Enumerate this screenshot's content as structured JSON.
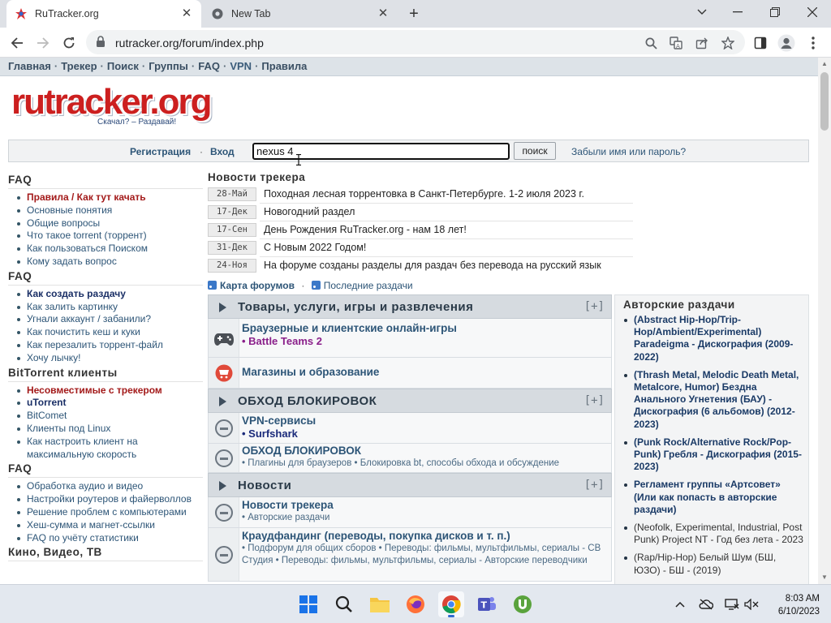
{
  "browser": {
    "tabs": [
      {
        "title": "RuTracker.org",
        "active": true
      },
      {
        "title": "New Tab",
        "active": false
      }
    ],
    "url": "rutracker.org/forum/index.php"
  },
  "topnav": {
    "items": [
      "Главная",
      "Трекер",
      "Поиск",
      "Группы",
      "FAQ",
      "VPN",
      "Правила"
    ],
    "separator": "·"
  },
  "logo": {
    "text": "rutracker.org",
    "slogan": "Скачал? – Раздавай!"
  },
  "login": {
    "register": "Регистрация",
    "dot": "·",
    "login": "Вход",
    "search_value": "nexus 4",
    "search_button": "поиск",
    "forgot": "Забыли имя или пароль?"
  },
  "sidebar": {
    "sections": [
      {
        "title": "FAQ",
        "items": [
          {
            "label": "Правила / Как тут качать",
            "style": "red"
          },
          {
            "label": "Основные понятия"
          },
          {
            "label": "Общие вопросы"
          },
          {
            "label": "Что такое torrent (торрент)"
          },
          {
            "label": "Как пользоваться Поиском"
          },
          {
            "label": "Кому задать вопрос"
          }
        ]
      },
      {
        "title": "FAQ",
        "items": [
          {
            "label": "Как создать раздачу",
            "style": "dark"
          },
          {
            "label": "Как залить картинку"
          },
          {
            "label": "Угнали аккаунт / забанили?"
          },
          {
            "label": "Как почистить кеш и куки"
          },
          {
            "label": "Как перезалить торрент-файл"
          },
          {
            "label": "Хочу лычку!"
          }
        ]
      },
      {
        "title": "BitTorrent клиенты",
        "items": [
          {
            "label": "Несовместимые с трекером",
            "style": "red"
          },
          {
            "label": "uTorrent",
            "style": "dark"
          },
          {
            "label": "BitComet"
          },
          {
            "label": "Клиенты под Linux"
          },
          {
            "label": "Как настроить клиент на максимальную скорость"
          }
        ]
      },
      {
        "title": "FAQ",
        "items": [
          {
            "label": "Обработка аудио и видео"
          },
          {
            "label": "Настройки роутеров и файерволлов"
          },
          {
            "label": "Решение проблем с компьютерами"
          },
          {
            "label": "Хеш-сумма и магнет-ссылки"
          },
          {
            "label": "FAQ по учёту статистики"
          }
        ]
      },
      {
        "title": "Кино, Видео, ТВ",
        "items": []
      }
    ]
  },
  "news": {
    "title": "Новости трекера",
    "items": [
      {
        "date": "28-Май",
        "text": "Походная лесная торрентовка в Санкт-Петербурге. 1-2 июля 2023 г."
      },
      {
        "date": "17-Дек",
        "text": "Новогодний раздел"
      },
      {
        "date": "17-Сен",
        "text": "День Рождения RuTracker.org - нам 18 лет!"
      },
      {
        "date": "31-Дек",
        "text": "С Новым 2022 Годом!"
      },
      {
        "date": "24-Ноя",
        "text": "На форуме созданы разделы для раздач без перевода на русский язык"
      }
    ],
    "map_link": "Карта форумов",
    "recent_link": "Последние раздачи"
  },
  "forums": {
    "categories": [
      {
        "title": "Товары, услуги, игры и развлечения",
        "toggle": "[+]",
        "rows": [
          {
            "icon": "gamepad-icon",
            "title": "Браузерные и клиентские онлайн-игры",
            "sub": "• Battle Teams 2",
            "sub_style": "purple"
          },
          {
            "icon": "shop-icon",
            "title": "Магазины и образование",
            "sub": ""
          }
        ]
      },
      {
        "title": "ОБХОД БЛОКИРОВОК",
        "toggle": "[+]",
        "rows": [
          {
            "icon": "forum-icon",
            "title": "VPN-сервисы",
            "sub": "• Surfshark",
            "sub_style": "navy"
          },
          {
            "icon": "forum-icon",
            "title": "ОБХОД БЛОКИРОВОК",
            "sub": "• Плагины для браузеров • Блокировка bt, способы обхода и обсуждение"
          }
        ]
      },
      {
        "title": "Новости",
        "toggle": "[+]",
        "rows": [
          {
            "icon": "forum-icon",
            "title": "Новости трекера",
            "sub": "• Авторские раздачи"
          },
          {
            "icon": "forum-icon",
            "title": "Краудфандинг (переводы, покупка дисков и т. п.)",
            "sub": "• Подфорум для общих сборов • Переводы: фильмы, мультфильмы, сериалы - СВ Студия • Переводы: фильмы, мультфильмы, сериалы - Авторские переводчики"
          }
        ]
      }
    ]
  },
  "author": {
    "title": "Авторские раздачи",
    "items": [
      {
        "label": "(Abstract Hip-Hop/Trip-Hop/Ambient/Experimental) Paradeigma - Дискография (2009-2022)",
        "bold": true
      },
      {
        "label": "(Thrash Metal, Melodic Death Metal, Metalcore, Humor) Бездна Анального Угнетения (БАУ) - Дискография (6 альбомов) (2012-2023)",
        "bold": true
      },
      {
        "label": "(Punk Rock/Alternative Rock/Pop-Punk) Гребля - Дискография (2015-2023)",
        "bold": true
      },
      {
        "label": "Регламент группы «Артсовет» (Или как попасть в авторские раздачи)",
        "bold": true
      },
      {
        "label": "(Neofolk, Experimental, Industrial, Post Punk) Project NT - Год без лета - 2023",
        "bold": false
      },
      {
        "label": "(Rap/Hip-Hop) Белый Шум (БШ, ЮЗО) - БШ - (2019)",
        "bold": false
      }
    ]
  },
  "taskbar": {
    "time": "8:03 AM",
    "date": "6/10/2023"
  },
  "colors": {
    "link": "#2d5577",
    "accent_red": "#cc1f1f",
    "nav_bg": "#dde3e8",
    "category_bg": "#d6dbe0"
  }
}
